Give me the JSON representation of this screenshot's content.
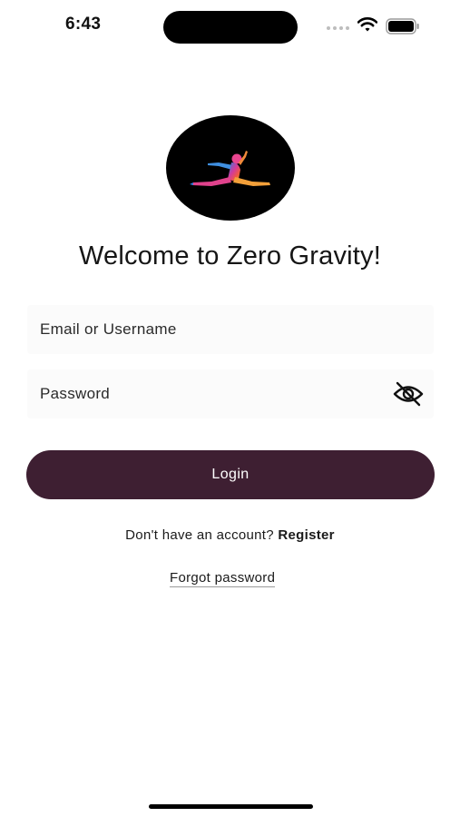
{
  "status_bar": {
    "time": "6:43",
    "icons": [
      "cellular-signal-icon",
      "wifi-icon",
      "battery-icon"
    ]
  },
  "logo": {
    "icon": "gymnast-leap-logo"
  },
  "title": "Welcome to Zero Gravity!",
  "form": {
    "email": {
      "placeholder": "Email or Username",
      "value": ""
    },
    "password": {
      "placeholder": "Password",
      "value": "",
      "toggle_icon": "eye-slash-icon"
    },
    "login_label": "Login"
  },
  "register": {
    "prompt": "Don't have an account? ",
    "link": "Register"
  },
  "forgot_password": "Forgot password",
  "colors": {
    "primary_button": "#3e1f32",
    "background": "#ffffff",
    "field_background": "#fbfbfb"
  }
}
